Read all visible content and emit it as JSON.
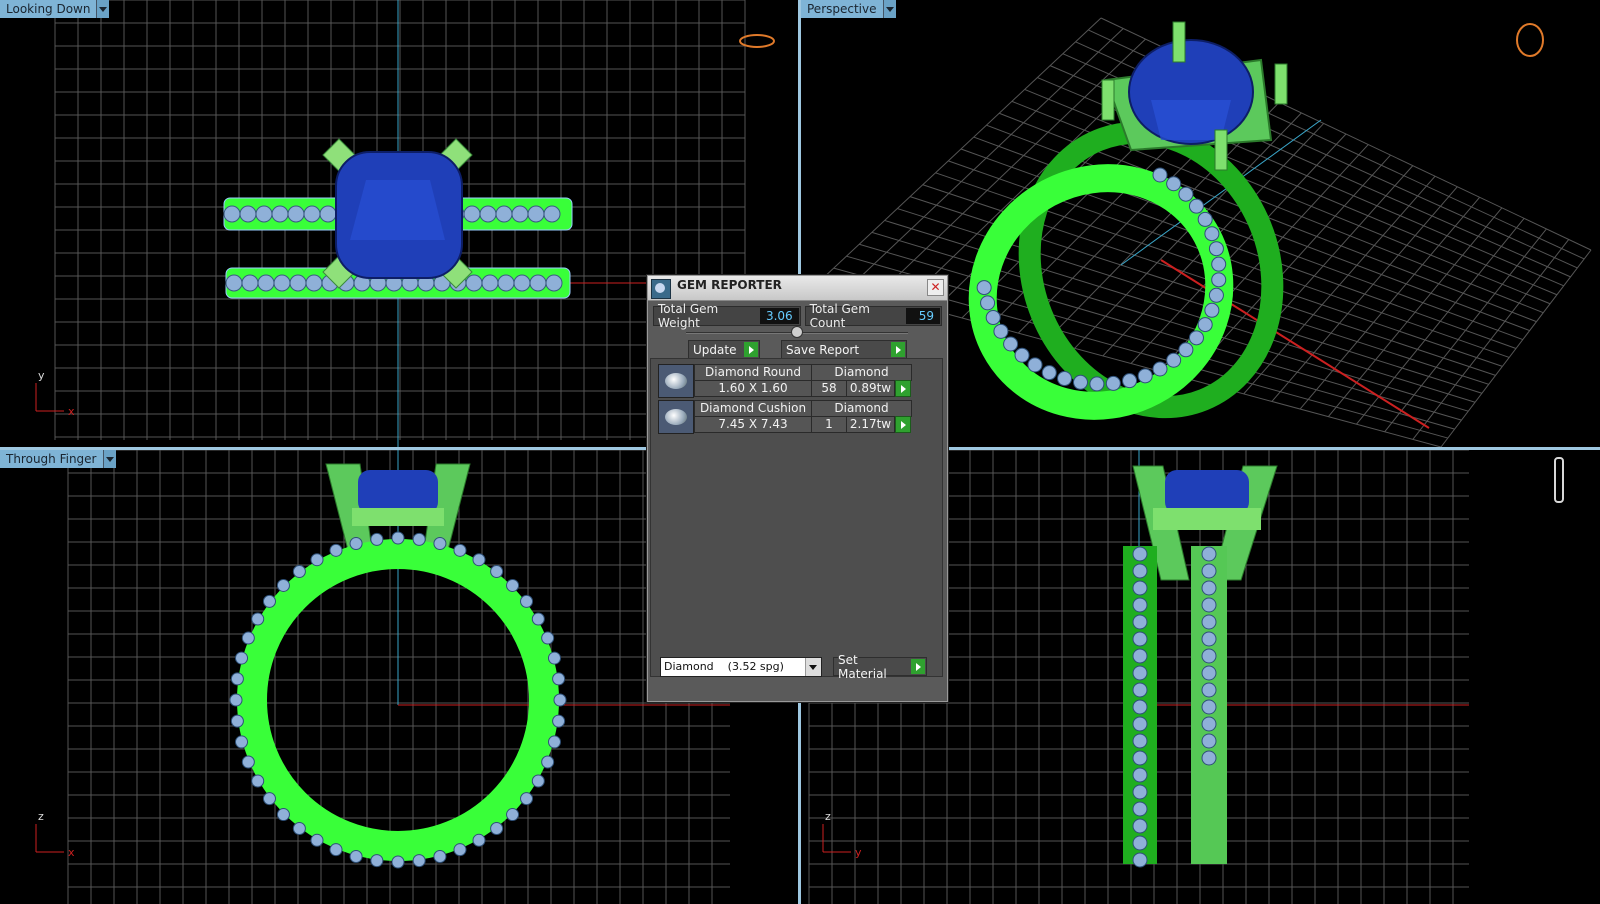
{
  "viewports": {
    "top_left": {
      "label": "Looking Down",
      "axis_v": "y",
      "axis_h": "x"
    },
    "top_right": {
      "label": "Perspective"
    },
    "bottom_left": {
      "label": "Through Finger",
      "axis_v": "z",
      "axis_h": "x"
    },
    "bottom_right": {
      "axis_v": "z",
      "axis_h": "y"
    }
  },
  "gem_reporter": {
    "title": "GEM REPORTER",
    "total_weight_label": "Total Gem Weight",
    "total_weight_value": "3.06",
    "total_count_label": "Total Gem Count",
    "total_count_value": "59",
    "update_label": "Update",
    "save_report_label": "Save Report",
    "rows": [
      {
        "name": "Diamond Round",
        "material": "Diamond",
        "size": "1.60 X 1.60",
        "count": "58",
        "weight": "0.89tw"
      },
      {
        "name": "Diamond Cushion",
        "material": "Diamond",
        "size": "7.45 X 7.43",
        "count": "1",
        "weight": "2.17tw"
      }
    ],
    "material_select": "Diamond    (3.52 spg)",
    "set_material_label": "Set Material"
  },
  "colors": {
    "metal": "#39ff39",
    "metal_dark": "#1fae1f",
    "gem_center": "#1f3fb8",
    "gem_side": "#8fb0d8",
    "grid": "#555555",
    "axis_red": "#cc2020",
    "axis_cyan": "#39a5c8",
    "viewport_label": "#7fb4d6"
  },
  "icons": [
    "view-ring-icon",
    "perspective-ring-icon",
    "through-finger-icon",
    "gem-reporter-icon",
    "close-icon",
    "play-arrow-icon",
    "dropdown-arrow-icon"
  ]
}
